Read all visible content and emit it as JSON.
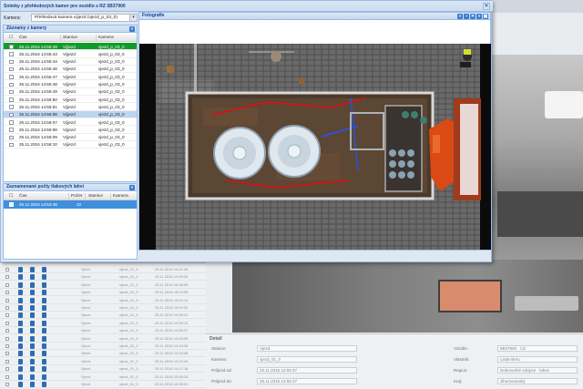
{
  "modal": {
    "title": "Snímky z přehledových kamer pro vozidlo s RZ 5B37900",
    "close_glyph": "✕"
  },
  "camera_select": {
    "label": "Kamera:",
    "value": "Přehledová kamera výjezd (vjezd_p_03_0)",
    "arrow": "▾"
  },
  "records_panel": {
    "title": "Záznamy z kamery",
    "tool_glyph": "»",
    "columns": [
      "Čas",
      "Stanice",
      "Kamera"
    ],
    "rows": [
      {
        "time": "25.11.2016 14:55:39",
        "station": "Výjezd",
        "camera": "vjezd_p_03_0"
      },
      {
        "time": "25.11.2016 14:55:43",
        "station": "Výjezd",
        "camera": "vjezd_p_03_0"
      },
      {
        "time": "25.11.2016 14:55:44",
        "station": "Výjezd",
        "camera": "vjezd_p_03_0"
      },
      {
        "time": "25.11.2016 14:55:46",
        "station": "Výjezd",
        "camera": "vjezd_p_03_0"
      },
      {
        "time": "25.11.2016 14:55:47",
        "station": "Výjezd",
        "camera": "vjezd_p_03_0"
      },
      {
        "time": "25.11.2016 14:55:48",
        "station": "Výjezd",
        "camera": "vjezd_p_03_0"
      },
      {
        "time": "25.11.2016 14:55:49",
        "station": "Výjezd",
        "camera": "vjezd_p_03_0"
      },
      {
        "time": "25.11.2016 14:55:50",
        "station": "Výjezd",
        "camera": "vjezd_p_03_0"
      },
      {
        "time": "25.11.2016 14:55:51",
        "station": "Výjezd",
        "camera": "vjezd_p_03_0"
      },
      {
        "time": "25.11.2016 14:56:06",
        "station": "Výjezd",
        "camera": "vjezd_p_03_0"
      },
      {
        "time": "25.11.2016 14:56:07",
        "station": "Výjezd",
        "camera": "vjezd_p_03_0"
      },
      {
        "time": "25.11.2016 14:56:08",
        "station": "Výjezd",
        "camera": "vjezd_p_03_0"
      },
      {
        "time": "25.11.2016 14:56:09",
        "station": "Výjezd",
        "camera": "vjezd_p_03_0"
      },
      {
        "time": "25.11.2016 14:56:10",
        "station": "Výjezd",
        "camera": "vjezd_p_03_0"
      }
    ]
  },
  "counts_panel": {
    "title": "Zaznamenané počty tlakových lahví",
    "tool_glyph": "»",
    "columns": [
      "Čas",
      "Počet",
      "Stanice",
      "Kamera"
    ],
    "rows": [
      {
        "time": "25.11.2016 14:53:49",
        "count": "22"
      }
    ]
  },
  "photo_panel": {
    "title": "Fotografie",
    "tool_glyphs": [
      "«",
      "▪",
      "✕",
      "»",
      "▣"
    ]
  },
  "bg_grid": {
    "rows": [
      {
        "dir": "Vjezd",
        "cam": "vjezd_01_0",
        "ts": "25.11.2016 14:41:45"
      },
      {
        "dir": "Vjezd",
        "cam": "vjezd_01_0",
        "ts": "25.11.2016 14:55:26"
      },
      {
        "dir": "Vjezd",
        "cam": "vjezd_01_0",
        "ts": "25.11.2016 15:48:59"
      },
      {
        "dir": "Vjezd",
        "cam": "vjezd_01_0",
        "ts": "25.11.2016 15:23:59"
      },
      {
        "dir": "Vjezd",
        "cam": "vjezd_01_0",
        "ts": "25.11.2016 15:22:14"
      },
      {
        "dir": "Vjezd",
        "cam": "vjezd_01_0",
        "ts": "25.11.2016 15:02:02"
      },
      {
        "dir": "Vjezd",
        "cam": "vjezd_01_0",
        "ts": "25.11.2016 14:59:31"
      },
      {
        "dir": "Vjezd",
        "cam": "vjezd_01_0",
        "ts": "25.11.2016 14:59:13"
      },
      {
        "dir": "Vjezd",
        "cam": "vjezd_01_0",
        "ts": "25.11.2016 14:55:37"
      },
      {
        "dir": "Vjezd",
        "cam": "vjezd_01_0",
        "ts": "25.11.2016 14:53:09"
      },
      {
        "dir": "Vjezd",
        "cam": "vjezd_01_0",
        "ts": "25.11.2016 14:44:36"
      },
      {
        "dir": "Vjezd",
        "cam": "vjezd_01_0",
        "ts": "25.11.2016 14:43:38"
      },
      {
        "dir": "Vjezd",
        "cam": "vjezd_01_0",
        "ts": "25.11.2016 14:22:34"
      },
      {
        "dir": "Vjezd",
        "cam": "vjezd_01_0",
        "ts": "25.11.2016 14:17:18"
      },
      {
        "dir": "Vjezd",
        "cam": "vjezd_01_0",
        "ts": "25.11.2016 13:55:20"
      },
      {
        "dir": "Vjezd",
        "cam": "vjezd_01_0",
        "ts": "25.11.2016 13:55:51"
      }
    ]
  },
  "detail": {
    "title": "Detail",
    "fields": [
      {
        "label": "Stanice:",
        "value": "Vjezd"
      },
      {
        "label": "Kamera:",
        "value": "vjezd_01_0"
      },
      {
        "label": "Průjezd od:",
        "value": "25.11.2016 14:55:37"
      },
      {
        "label": "Průjezd do:",
        "value": "25.11.2016 14:55:37"
      }
    ],
    "right_fields": [
      {
        "label": "Vozidlo:",
        "value": "5B37900 · CZ"
      },
      {
        "label": "Vlastník:",
        "value": "Linde Brno"
      },
      {
        "label": "Region:",
        "value": "Dobrovolné Adopce · lahve"
      },
      {
        "label": "Kraj:",
        "value": "Jihomoravský"
      }
    ]
  }
}
